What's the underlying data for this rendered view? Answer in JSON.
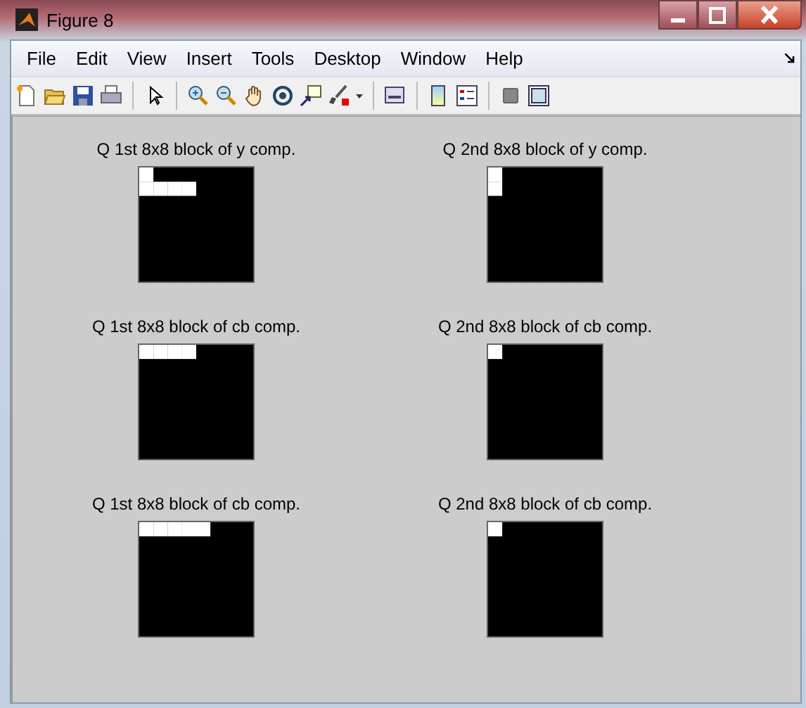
{
  "window": {
    "title": "Figure 8"
  },
  "menu": [
    "File",
    "Edit",
    "View",
    "Insert",
    "Tools",
    "Desktop",
    "Window",
    "Help"
  ],
  "axes": [
    {
      "title": "Q 1st 8x8 block of y comp.",
      "pixels": [
        [
          {
            "white": true
          },
          {
            "white": false
          },
          {
            "white": false
          },
          {
            "white": false
          },
          {
            "white": false
          },
          {
            "white": false
          },
          {
            "white": false
          },
          {
            "white": false
          }
        ],
        [
          {
            "white": true
          },
          {
            "white": true
          },
          {
            "white": true
          },
          {
            "white": true
          },
          {
            "white": false
          },
          {
            "white": false
          },
          {
            "white": false
          },
          {
            "white": false
          }
        ],
        [
          {
            "white": false
          },
          {
            "white": false
          },
          {
            "white": false
          },
          {
            "white": false
          },
          {
            "white": false
          },
          {
            "white": false
          },
          {
            "white": false
          },
          {
            "white": false
          }
        ],
        [
          {
            "white": false
          },
          {
            "white": false
          },
          {
            "white": false
          },
          {
            "white": false
          },
          {
            "white": false
          },
          {
            "white": false
          },
          {
            "white": false
          },
          {
            "white": false
          }
        ],
        [
          {
            "white": false
          },
          {
            "white": false
          },
          {
            "white": false
          },
          {
            "white": false
          },
          {
            "white": false
          },
          {
            "white": false
          },
          {
            "white": false
          },
          {
            "white": false
          }
        ],
        [
          {
            "white": false
          },
          {
            "white": false
          },
          {
            "white": false
          },
          {
            "white": false
          },
          {
            "white": false
          },
          {
            "white": false
          },
          {
            "white": false
          },
          {
            "white": false
          }
        ],
        [
          {
            "white": false
          },
          {
            "white": false
          },
          {
            "white": false
          },
          {
            "white": false
          },
          {
            "white": false
          },
          {
            "white": false
          },
          {
            "white": false
          },
          {
            "white": false
          }
        ],
        [
          {
            "white": false
          },
          {
            "white": false
          },
          {
            "white": false
          },
          {
            "white": false
          },
          {
            "white": false
          },
          {
            "white": false
          },
          {
            "white": false
          },
          {
            "white": false
          }
        ]
      ]
    },
    {
      "title": "Q 2nd 8x8 block of y comp.",
      "pixels": [
        [
          {
            "white": true
          },
          {
            "white": false
          },
          {
            "white": false
          },
          {
            "white": false
          },
          {
            "white": false
          },
          {
            "white": false
          },
          {
            "white": false
          },
          {
            "white": false
          }
        ],
        [
          {
            "white": true
          },
          {
            "white": false
          },
          {
            "white": false
          },
          {
            "white": false
          },
          {
            "white": false
          },
          {
            "white": false
          },
          {
            "white": false
          },
          {
            "white": false
          }
        ],
        [
          {
            "white": false
          },
          {
            "white": false
          },
          {
            "white": false
          },
          {
            "white": false
          },
          {
            "white": false
          },
          {
            "white": false
          },
          {
            "white": false
          },
          {
            "white": false
          }
        ],
        [
          {
            "white": false
          },
          {
            "white": false
          },
          {
            "white": false
          },
          {
            "white": false
          },
          {
            "white": false
          },
          {
            "white": false
          },
          {
            "white": false
          },
          {
            "white": false
          }
        ],
        [
          {
            "white": false
          },
          {
            "white": false
          },
          {
            "white": false
          },
          {
            "white": false
          },
          {
            "white": false
          },
          {
            "white": false
          },
          {
            "white": false
          },
          {
            "white": false
          }
        ],
        [
          {
            "white": false
          },
          {
            "white": false
          },
          {
            "white": false
          },
          {
            "white": false
          },
          {
            "white": false
          },
          {
            "white": false
          },
          {
            "white": false
          },
          {
            "white": false
          }
        ],
        [
          {
            "white": false
          },
          {
            "white": false
          },
          {
            "white": false
          },
          {
            "white": false
          },
          {
            "white": false
          },
          {
            "white": false
          },
          {
            "white": false
          },
          {
            "white": false
          }
        ],
        [
          {
            "white": false
          },
          {
            "white": false
          },
          {
            "white": false
          },
          {
            "white": false
          },
          {
            "white": false
          },
          {
            "white": false
          },
          {
            "white": false
          },
          {
            "white": false
          }
        ]
      ]
    },
    {
      "title": "Q 1st 8x8 block of cb comp.",
      "pixels": [
        [
          {
            "white": true
          },
          {
            "white": true
          },
          {
            "white": true
          },
          {
            "white": true
          },
          {
            "white": false
          },
          {
            "white": false
          },
          {
            "white": false
          },
          {
            "white": false
          }
        ],
        [
          {
            "white": false
          },
          {
            "white": false
          },
          {
            "white": false
          },
          {
            "white": false
          },
          {
            "white": false
          },
          {
            "white": false
          },
          {
            "white": false
          },
          {
            "white": false
          }
        ],
        [
          {
            "white": false
          },
          {
            "white": false
          },
          {
            "white": false
          },
          {
            "white": false
          },
          {
            "white": false
          },
          {
            "white": false
          },
          {
            "white": false
          },
          {
            "white": false
          }
        ],
        [
          {
            "white": false
          },
          {
            "white": false
          },
          {
            "white": false
          },
          {
            "white": false
          },
          {
            "white": false
          },
          {
            "white": false
          },
          {
            "white": false
          },
          {
            "white": false
          }
        ],
        [
          {
            "white": false
          },
          {
            "white": false
          },
          {
            "white": false
          },
          {
            "white": false
          },
          {
            "white": false
          },
          {
            "white": false
          },
          {
            "white": false
          },
          {
            "white": false
          }
        ],
        [
          {
            "white": false
          },
          {
            "white": false
          },
          {
            "white": false
          },
          {
            "white": false
          },
          {
            "white": false
          },
          {
            "white": false
          },
          {
            "white": false
          },
          {
            "white": false
          }
        ],
        [
          {
            "white": false
          },
          {
            "white": false
          },
          {
            "white": false
          },
          {
            "white": false
          },
          {
            "white": false
          },
          {
            "white": false
          },
          {
            "white": false
          },
          {
            "white": false
          }
        ],
        [
          {
            "white": false
          },
          {
            "white": false
          },
          {
            "white": false
          },
          {
            "white": false
          },
          {
            "white": false
          },
          {
            "white": false
          },
          {
            "white": false
          },
          {
            "white": false
          }
        ]
      ]
    },
    {
      "title": "Q 2nd 8x8 block of cb comp.",
      "pixels": [
        [
          {
            "white": true
          },
          {
            "white": false
          },
          {
            "white": false
          },
          {
            "white": false
          },
          {
            "white": false
          },
          {
            "white": false
          },
          {
            "white": false
          },
          {
            "white": false
          }
        ],
        [
          {
            "white": false
          },
          {
            "white": false
          },
          {
            "white": false
          },
          {
            "white": false
          },
          {
            "white": false
          },
          {
            "white": false
          },
          {
            "white": false
          },
          {
            "white": false
          }
        ],
        [
          {
            "white": false
          },
          {
            "white": false
          },
          {
            "white": false
          },
          {
            "white": false
          },
          {
            "white": false
          },
          {
            "white": false
          },
          {
            "white": false
          },
          {
            "white": false
          }
        ],
        [
          {
            "white": false
          },
          {
            "white": false
          },
          {
            "white": false
          },
          {
            "white": false
          },
          {
            "white": false
          },
          {
            "white": false
          },
          {
            "white": false
          },
          {
            "white": false
          }
        ],
        [
          {
            "white": false
          },
          {
            "white": false
          },
          {
            "white": false
          },
          {
            "white": false
          },
          {
            "white": false
          },
          {
            "white": false
          },
          {
            "white": false
          },
          {
            "white": false
          }
        ],
        [
          {
            "white": false
          },
          {
            "white": false
          },
          {
            "white": false
          },
          {
            "white": false
          },
          {
            "white": false
          },
          {
            "white": false
          },
          {
            "white": false
          },
          {
            "white": false
          }
        ],
        [
          {
            "white": false
          },
          {
            "white": false
          },
          {
            "white": false
          },
          {
            "white": false
          },
          {
            "white": false
          },
          {
            "white": false
          },
          {
            "white": false
          },
          {
            "white": false
          }
        ],
        [
          {
            "white": false
          },
          {
            "white": false
          },
          {
            "white": false
          },
          {
            "white": false
          },
          {
            "white": false
          },
          {
            "white": false
          },
          {
            "white": false
          },
          {
            "white": false
          }
        ]
      ]
    },
    {
      "title": "Q 1st 8x8 block of cb comp.",
      "pixels": [
        [
          {
            "white": true
          },
          {
            "white": true
          },
          {
            "white": true
          },
          {
            "white": true
          },
          {
            "white": true
          },
          {
            "white": false
          },
          {
            "white": false
          },
          {
            "white": false
          }
        ],
        [
          {
            "white": false
          },
          {
            "white": false
          },
          {
            "white": false
          },
          {
            "white": false
          },
          {
            "white": false
          },
          {
            "white": false
          },
          {
            "white": false
          },
          {
            "white": false
          }
        ],
        [
          {
            "white": false
          },
          {
            "white": false
          },
          {
            "white": false
          },
          {
            "white": false
          },
          {
            "white": false
          },
          {
            "white": false
          },
          {
            "white": false
          },
          {
            "white": false
          }
        ],
        [
          {
            "white": false
          },
          {
            "white": false
          },
          {
            "white": false
          },
          {
            "white": false
          },
          {
            "white": false
          },
          {
            "white": false
          },
          {
            "white": false
          },
          {
            "white": false
          }
        ],
        [
          {
            "white": false
          },
          {
            "white": false
          },
          {
            "white": false
          },
          {
            "white": false
          },
          {
            "white": false
          },
          {
            "white": false
          },
          {
            "white": false
          },
          {
            "white": false
          }
        ],
        [
          {
            "white": false
          },
          {
            "white": false
          },
          {
            "white": false
          },
          {
            "white": false
          },
          {
            "white": false
          },
          {
            "white": false
          },
          {
            "white": false
          },
          {
            "white": false
          }
        ],
        [
          {
            "white": false
          },
          {
            "white": false
          },
          {
            "white": false
          },
          {
            "white": false
          },
          {
            "white": false
          },
          {
            "white": false
          },
          {
            "white": false
          },
          {
            "white": false
          }
        ],
        [
          {
            "white": false
          },
          {
            "white": false
          },
          {
            "white": false
          },
          {
            "white": false
          },
          {
            "white": false
          },
          {
            "white": false
          },
          {
            "white": false
          },
          {
            "white": false
          }
        ]
      ]
    },
    {
      "title": "Q 2nd 8x8 block of cb comp.",
      "pixels": [
        [
          {
            "white": true
          },
          {
            "white": false
          },
          {
            "white": false
          },
          {
            "white": false
          },
          {
            "white": false
          },
          {
            "white": false
          },
          {
            "white": false
          },
          {
            "white": false
          }
        ],
        [
          {
            "white": false
          },
          {
            "white": false
          },
          {
            "white": false
          },
          {
            "white": false
          },
          {
            "white": false
          },
          {
            "white": false
          },
          {
            "white": false
          },
          {
            "white": false
          }
        ],
        [
          {
            "white": false
          },
          {
            "white": false
          },
          {
            "white": false
          },
          {
            "white": false
          },
          {
            "white": false
          },
          {
            "white": false
          },
          {
            "white": false
          },
          {
            "white": false
          }
        ],
        [
          {
            "white": false
          },
          {
            "white": false
          },
          {
            "white": false
          },
          {
            "white": false
          },
          {
            "white": false
          },
          {
            "white": false
          },
          {
            "white": false
          },
          {
            "white": false
          }
        ],
        [
          {
            "white": false
          },
          {
            "white": false
          },
          {
            "white": false
          },
          {
            "white": false
          },
          {
            "white": false
          },
          {
            "white": false
          },
          {
            "white": false
          },
          {
            "white": false
          }
        ],
        [
          {
            "white": false
          },
          {
            "white": false
          },
          {
            "white": false
          },
          {
            "white": false
          },
          {
            "white": false
          },
          {
            "white": false
          },
          {
            "white": false
          },
          {
            "white": false
          }
        ],
        [
          {
            "white": false
          },
          {
            "white": false
          },
          {
            "white": false
          },
          {
            "white": false
          },
          {
            "white": false
          },
          {
            "white": false
          },
          {
            "white": false
          },
          {
            "white": false
          }
        ],
        [
          {
            "white": false
          },
          {
            "white": false
          },
          {
            "white": false
          },
          {
            "white": false
          },
          {
            "white": false
          },
          {
            "white": false
          },
          {
            "white": false
          },
          {
            "white": false
          }
        ]
      ]
    }
  ]
}
